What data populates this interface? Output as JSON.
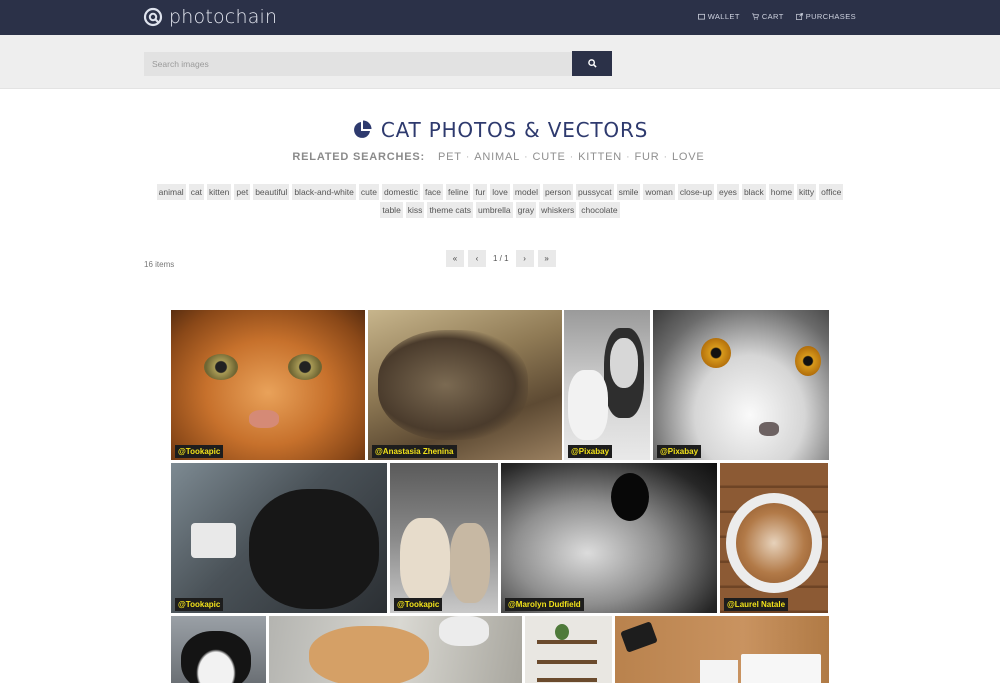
{
  "brand": {
    "name": "photochain"
  },
  "nav": {
    "wallet": "WALLET",
    "cart": "CART",
    "purchases": "PURCHASES"
  },
  "search": {
    "placeholder": "Search images"
  },
  "heading": {
    "title": "CAT PHOTOS & VECTORS"
  },
  "related": {
    "label": "RELATED SEARCHES:",
    "terms": [
      "PET",
      "ANIMAL",
      "CUTE",
      "KITTEN",
      "FUR",
      "LOVE"
    ]
  },
  "tags": [
    "animal",
    "cat",
    "kitten",
    "pet",
    "beautiful",
    "black-and-white",
    "cute",
    "domestic",
    "face",
    "feline",
    "fur",
    "love",
    "model",
    "person",
    "pussycat",
    "smile",
    "woman",
    "close-up",
    "eyes",
    "black",
    "home",
    "kitty",
    "office",
    "table",
    "kiss",
    "theme cats",
    "umbrella",
    "gray",
    "whiskers",
    "chocolate"
  ],
  "results": {
    "count": "16 items"
  },
  "pagination": {
    "first": "«",
    "prev": "‹",
    "info": "1 / 1",
    "next": "›",
    "last": "»"
  },
  "photos": [
    {
      "credit": "@Tookapic"
    },
    {
      "credit": "@Anastasia Zhenina"
    },
    {
      "credit": "@Pixabay"
    },
    {
      "credit": "@Pixabay"
    },
    {
      "credit": "@Tookapic"
    },
    {
      "credit": "@Tookapic"
    },
    {
      "credit": "@Marolyn Dudfield"
    },
    {
      "credit": "@Laurel Natale"
    },
    {
      "credit": ""
    },
    {
      "credit": ""
    },
    {
      "credit": ""
    },
    {
      "credit": ""
    }
  ]
}
